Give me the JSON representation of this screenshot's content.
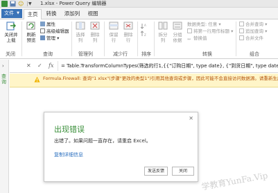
{
  "window": {
    "title": "1.xlsx - Power Query 编辑器"
  },
  "tabs": {
    "file": "文件",
    "items": [
      "主页",
      "转换",
      "添加列",
      "视图"
    ],
    "active": "主页"
  },
  "ribbon": {
    "close_apply": "关闭并\n上载",
    "close_group": "关闭",
    "refresh_preview": "刷新\n预览",
    "properties": "属性",
    "advanced_editor": "高级编辑器",
    "manage": "管理",
    "query_group": "查询",
    "choose_columns": "选择\n列",
    "remove_columns": "删除\n列",
    "manage_columns_group": "管理列",
    "keep_rows": "保留\n行",
    "remove_rows": "删除\n行",
    "reduce_rows_group": "减少行",
    "sort_group": "排序",
    "split_column": "拆分\n列",
    "group_by": "分组\n依据",
    "data_type": "数据类型: 任意",
    "use_first_row": "将第一行用作标题",
    "replace_values": "替换值",
    "transform_group": "转换",
    "merge_queries": "合并查询",
    "append_queries": "追加查询",
    "combine_files": "合并文件",
    "combine_group": "组合"
  },
  "queries_pane": {
    "label": "查询"
  },
  "formula_bar": {
    "formula": "= Table.TransformColumnTypes(筛选的行1,{{\"订购日期\", type date}, {\"到货日期\", type date},"
  },
  "warning": {
    "text": "Formula.Firewall: 查询\"1 xlsx\"(步骤\"更改的类型1\")引用其他查询或步骤，因此可能不会直接访问数据源。请重新生成此数据组合。"
  },
  "dialog": {
    "title": "出现错误",
    "message": "出错了。如果问题一直存在，请重启 Excel。",
    "details_link": "复制详细信息",
    "send_feedback": "发送反馈",
    "close": "关闭"
  },
  "watermark": "学教育YunFa.Vip",
  "colors": {
    "accent_blue": "#3a73b8",
    "title_green": "#3a8f3a",
    "warning_bg": "#fff5c8",
    "warning_text": "#b4520a",
    "link_blue": "#2a6fbf"
  }
}
